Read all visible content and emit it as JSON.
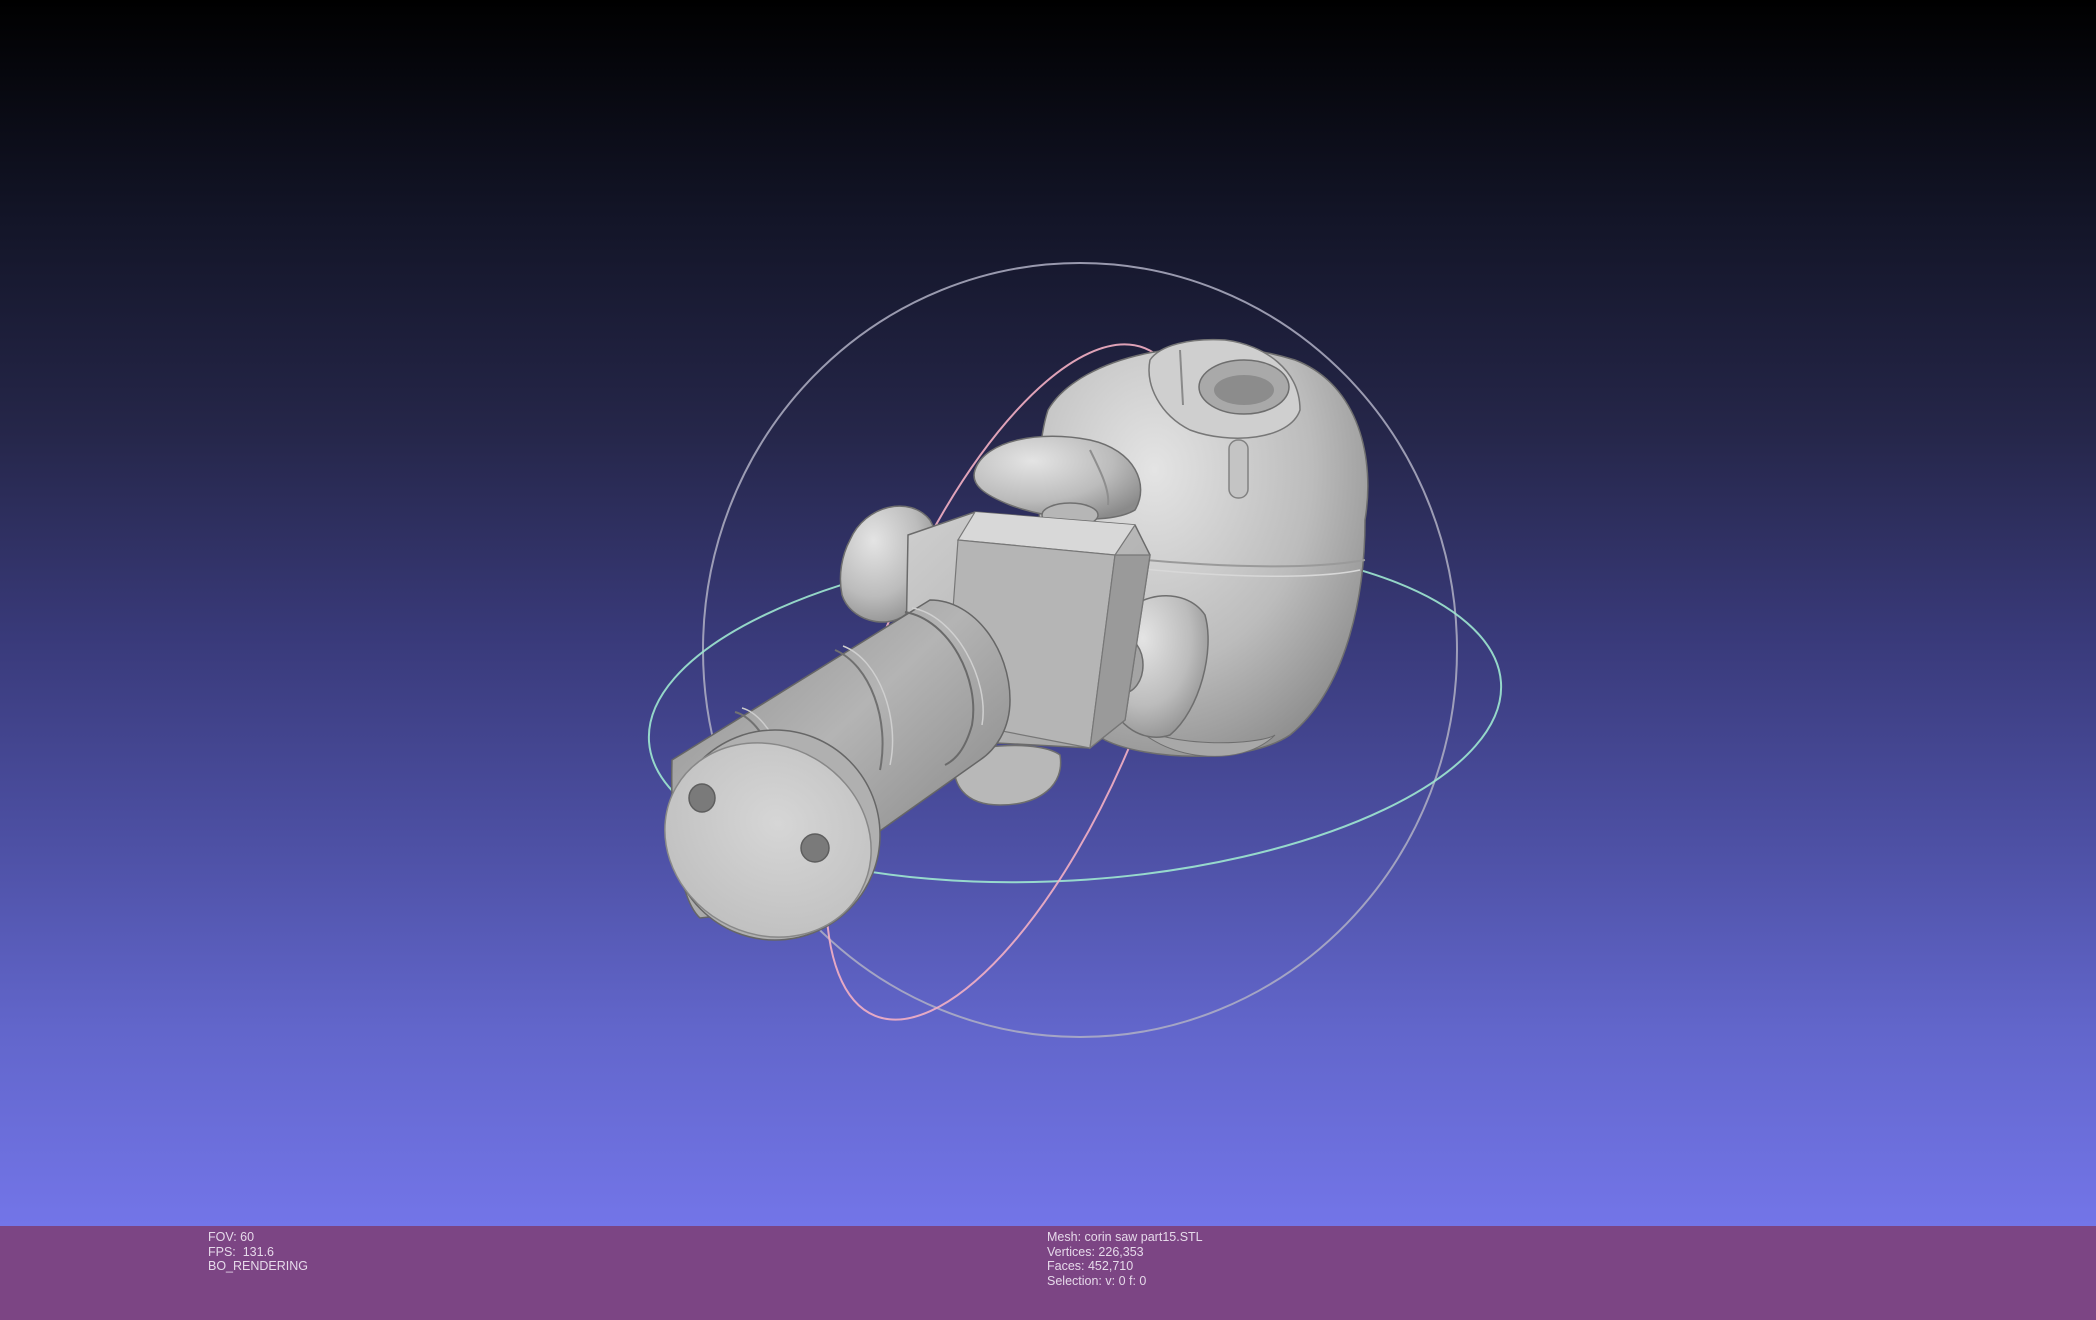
{
  "app": {
    "window_title": ""
  },
  "viewport": {
    "background_top": "#000000",
    "background_bottom": "#7375e8",
    "model_color": "#c8c8c8",
    "trackball_colors": {
      "x_ring": "#ffb6c8",
      "y_ring": "#a8ffd8",
      "z_ring": "#c8c8d8"
    }
  },
  "info": {
    "left": {
      "fov": "FOV: 60",
      "fps": "FPS:  131.6",
      "mode": "BO_RENDERING"
    },
    "right": {
      "mesh": "Mesh: corin saw part15.STL",
      "vertices": "Vertices: 226,353",
      "faces": "Faces: 452,710",
      "selection": "Selection: v: 0 f: 0"
    },
    "bar_color": "#7c4584"
  }
}
